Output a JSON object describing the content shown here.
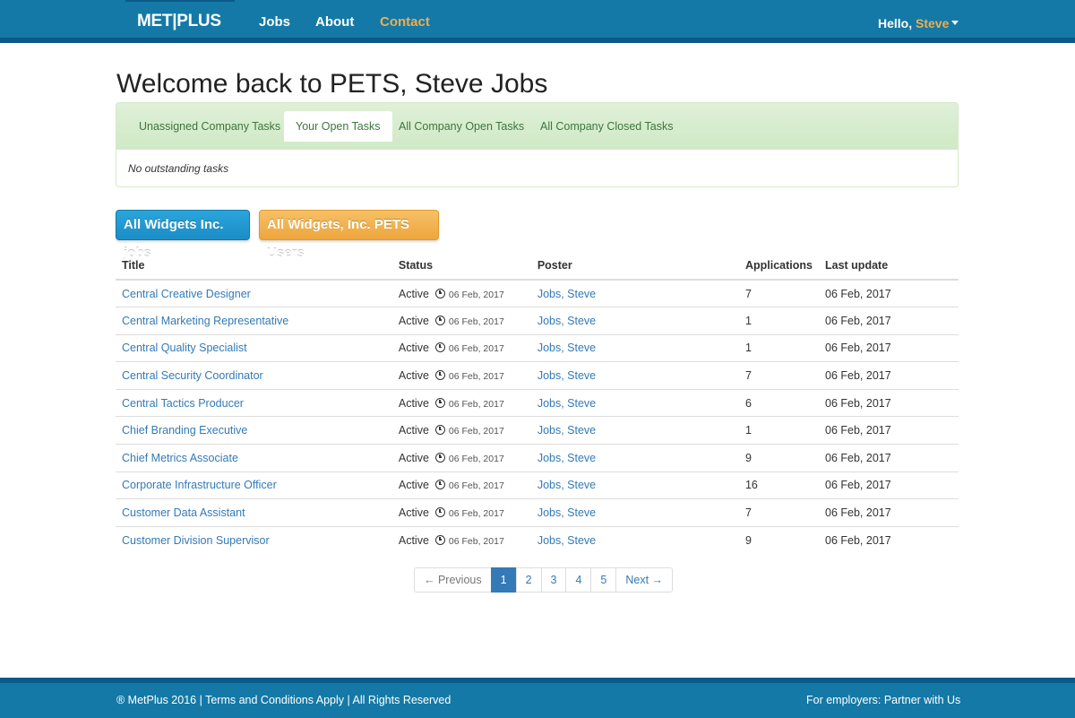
{
  "navbar": {
    "brand": "MET|PLUS",
    "links": [
      {
        "label": "Jobs",
        "active": false
      },
      {
        "label": "About",
        "active": false
      },
      {
        "label": "Contact",
        "active": true
      }
    ],
    "greeting": "Hello,",
    "user": "Steve"
  },
  "page": {
    "title": "Welcome back to PETS, Steve Jobs"
  },
  "tasks_panel": {
    "tabs": [
      {
        "label": "Unassigned Company Tasks",
        "active": false
      },
      {
        "label": "Your Open Tasks",
        "active": true
      },
      {
        "label": "All Company Open Tasks",
        "active": false
      },
      {
        "label": "All Company Closed Tasks",
        "active": false
      }
    ],
    "empty_message": "No outstanding tasks"
  },
  "buttons": {
    "jobs": "All Widgets Inc. jobs",
    "users": "All Widgets, Inc. PETS Users"
  },
  "table": {
    "headers": [
      "Title",
      "Status",
      "Poster",
      "Applications",
      "Last update"
    ],
    "rows": [
      {
        "title": "Central Creative Designer",
        "status": "Active",
        "status_date": "06 Feb, 2017",
        "poster": "Jobs, Steve",
        "applications": "7",
        "last_update": "06 Feb, 2017"
      },
      {
        "title": "Central Marketing Representative",
        "status": "Active",
        "status_date": "06 Feb, 2017",
        "poster": "Jobs, Steve",
        "applications": "1",
        "last_update": "06 Feb, 2017"
      },
      {
        "title": "Central Quality Specialist",
        "status": "Active",
        "status_date": "06 Feb, 2017",
        "poster": "Jobs, Steve",
        "applications": "1",
        "last_update": "06 Feb, 2017"
      },
      {
        "title": "Central Security Coordinator",
        "status": "Active",
        "status_date": "06 Feb, 2017",
        "poster": "Jobs, Steve",
        "applications": "7",
        "last_update": "06 Feb, 2017"
      },
      {
        "title": "Central Tactics Producer",
        "status": "Active",
        "status_date": "06 Feb, 2017",
        "poster": "Jobs, Steve",
        "applications": "6",
        "last_update": "06 Feb, 2017"
      },
      {
        "title": "Chief Branding Executive",
        "status": "Active",
        "status_date": "06 Feb, 2017",
        "poster": "Jobs, Steve",
        "applications": "1",
        "last_update": "06 Feb, 2017"
      },
      {
        "title": "Chief Metrics Associate",
        "status": "Active",
        "status_date": "06 Feb, 2017",
        "poster": "Jobs, Steve",
        "applications": "9",
        "last_update": "06 Feb, 2017"
      },
      {
        "title": "Corporate Infrastructure Officer",
        "status": "Active",
        "status_date": "06 Feb, 2017",
        "poster": "Jobs, Steve",
        "applications": "16",
        "last_update": "06 Feb, 2017"
      },
      {
        "title": "Customer Data Assistant",
        "status": "Active",
        "status_date": "06 Feb, 2017",
        "poster": "Jobs, Steve",
        "applications": "7",
        "last_update": "06 Feb, 2017"
      },
      {
        "title": "Customer Division Supervisor",
        "status": "Active",
        "status_date": "06 Feb, 2017",
        "poster": "Jobs, Steve",
        "applications": "9",
        "last_update": "06 Feb, 2017"
      }
    ]
  },
  "pagination": {
    "previous": "← Previous",
    "pages": [
      "1",
      "2",
      "3",
      "4",
      "5"
    ],
    "current": "1",
    "next": "Next →"
  },
  "footer": {
    "left_prefix": "® MetPlus 2016 |",
    "terms": "Terms and Conditions Apply",
    "left_suffix": "| All Rights Reserved",
    "right_prefix": "For employers:",
    "partner": "Partner with Us"
  },
  "colors": {
    "navbar": "#1479a6",
    "accent_orange": "#f0ad4e",
    "link_blue": "#337ab7",
    "tab_green": "#3c763d"
  }
}
